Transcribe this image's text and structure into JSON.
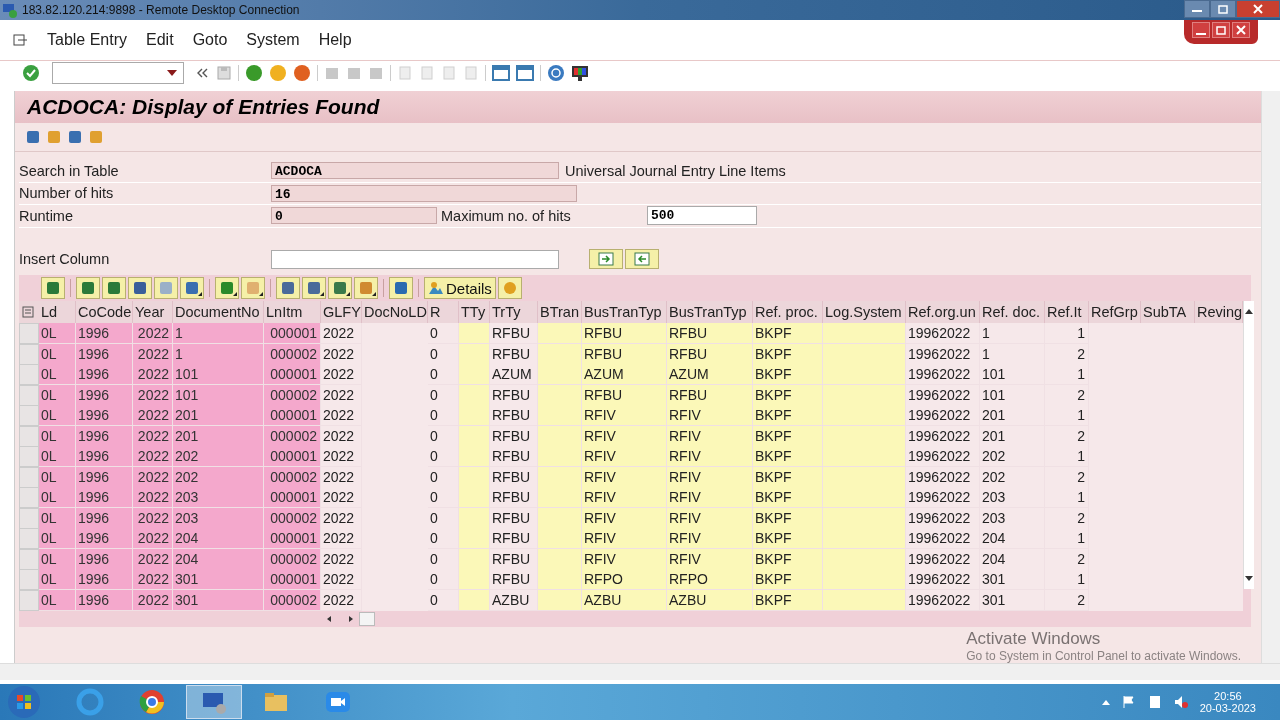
{
  "window": {
    "title": "183.82.120.214:9898 - Remote Desktop Connection"
  },
  "menu": [
    "Table Entry",
    "Edit",
    "Goto",
    "System",
    "Help"
  ],
  "screen_title": "ACDOCA: Display of Entries Found",
  "fields": [
    {
      "label": "Search in Table",
      "value": "ACDOCA",
      "description": "Universal Journal Entry Line Items"
    },
    {
      "label": "Number of hits",
      "value": "16"
    },
    {
      "label": "Runtime",
      "value": "0"
    }
  ],
  "max_hits": {
    "label": "Maximum no. of hits",
    "value": "500"
  },
  "insert_column": {
    "label": "Insert Column"
  },
  "grid": {
    "details_label": "Details",
    "columns": [
      {
        "label": "Ld",
        "kind": "key"
      },
      {
        "label": "CoCode",
        "kind": "key"
      },
      {
        "label": "Year",
        "kind": "key"
      },
      {
        "label": "DocumentNo",
        "kind": "key"
      },
      {
        "label": "LnItm",
        "kind": "key"
      },
      {
        "label": "GLFY",
        "kind": "plain"
      },
      {
        "label": "DocNoLD",
        "kind": "plain"
      },
      {
        "label": "R",
        "kind": "plain"
      },
      {
        "label": "TTy",
        "kind": "input"
      },
      {
        "label": "TrTy",
        "kind": "plain"
      },
      {
        "label": "BTran",
        "kind": "input"
      },
      {
        "label": "BusTranTyp",
        "kind": "input"
      },
      {
        "label": "BusTranTyp",
        "kind": "input"
      },
      {
        "label": "Ref. proc.",
        "kind": "input"
      },
      {
        "label": "Log.System",
        "kind": "input"
      },
      {
        "label": "Ref.org.un",
        "kind": "plain"
      },
      {
        "label": "Ref. doc.",
        "kind": "plain"
      },
      {
        "label": "Ref.It",
        "kind": "plain"
      },
      {
        "label": "RefGrp",
        "kind": "plain"
      },
      {
        "label": "SubTA",
        "kind": "plain"
      },
      {
        "label": "Reving",
        "kind": "plain"
      }
    ],
    "rows": [
      [
        "0L",
        "1996",
        "2022",
        "1",
        "000001",
        "2022",
        null,
        "0",
        null,
        "RFBU",
        null,
        "RFBU",
        "RFBU",
        "BKPF",
        null,
        "19962022",
        "1",
        "1",
        null,
        null,
        null
      ],
      [
        "0L",
        "1996",
        "2022",
        "1",
        "000002",
        "2022",
        null,
        "0",
        null,
        "RFBU",
        null,
        "RFBU",
        "RFBU",
        "BKPF",
        null,
        "19962022",
        "1",
        "2",
        null,
        null,
        null
      ],
      [
        "0L",
        "1996",
        "2022",
        "101",
        "000001",
        "2022",
        null,
        "0",
        null,
        "AZUM",
        null,
        "AZUM",
        "AZUM",
        "BKPF",
        null,
        "19962022",
        "101",
        "1",
        null,
        null,
        null
      ],
      [
        "0L",
        "1996",
        "2022",
        "101",
        "000002",
        "2022",
        null,
        "0",
        null,
        "RFBU",
        null,
        "RFBU",
        "RFBU",
        "BKPF",
        null,
        "19962022",
        "101",
        "2",
        null,
        null,
        null
      ],
      [
        "0L",
        "1996",
        "2022",
        "201",
        "000001",
        "2022",
        null,
        "0",
        null,
        "RFBU",
        null,
        "RFIV",
        "RFIV",
        "BKPF",
        null,
        "19962022",
        "201",
        "1",
        null,
        null,
        null
      ],
      [
        "0L",
        "1996",
        "2022",
        "201",
        "000002",
        "2022",
        null,
        "0",
        null,
        "RFBU",
        null,
        "RFIV",
        "RFIV",
        "BKPF",
        null,
        "19962022",
        "201",
        "2",
        null,
        null,
        null
      ],
      [
        "0L",
        "1996",
        "2022",
        "202",
        "000001",
        "2022",
        null,
        "0",
        null,
        "RFBU",
        null,
        "RFIV",
        "RFIV",
        "BKPF",
        null,
        "19962022",
        "202",
        "1",
        null,
        null,
        null
      ],
      [
        "0L",
        "1996",
        "2022",
        "202",
        "000002",
        "2022",
        null,
        "0",
        null,
        "RFBU",
        null,
        "RFIV",
        "RFIV",
        "BKPF",
        null,
        "19962022",
        "202",
        "2",
        null,
        null,
        null
      ],
      [
        "0L",
        "1996",
        "2022",
        "203",
        "000001",
        "2022",
        null,
        "0",
        null,
        "RFBU",
        null,
        "RFIV",
        "RFIV",
        "BKPF",
        null,
        "19962022",
        "203",
        "1",
        null,
        null,
        null
      ],
      [
        "0L",
        "1996",
        "2022",
        "203",
        "000002",
        "2022",
        null,
        "0",
        null,
        "RFBU",
        null,
        "RFIV",
        "RFIV",
        "BKPF",
        null,
        "19962022",
        "203",
        "2",
        null,
        null,
        null
      ],
      [
        "0L",
        "1996",
        "2022",
        "204",
        "000001",
        "2022",
        null,
        "0",
        null,
        "RFBU",
        null,
        "RFIV",
        "RFIV",
        "BKPF",
        null,
        "19962022",
        "204",
        "1",
        null,
        null,
        null
      ],
      [
        "0L",
        "1996",
        "2022",
        "204",
        "000002",
        "2022",
        null,
        "0",
        null,
        "RFBU",
        null,
        "RFIV",
        "RFIV",
        "BKPF",
        null,
        "19962022",
        "204",
        "2",
        null,
        null,
        null
      ],
      [
        "0L",
        "1996",
        "2022",
        "301",
        "000001",
        "2022",
        null,
        "0",
        null,
        "RFBU",
        null,
        "RFPO",
        "RFPO",
        "BKPF",
        null,
        "19962022",
        "301",
        "1",
        null,
        null,
        null
      ],
      [
        "0L",
        "1996",
        "2022",
        "301",
        "000002",
        "2022",
        null,
        "0",
        null,
        "AZBU",
        null,
        "AZBU",
        "AZBU",
        "BKPF",
        null,
        "19962022",
        "301",
        "2",
        null,
        null,
        null
      ]
    ]
  },
  "watermark": {
    "title": "Activate Windows",
    "text": "Go to System in Control Panel to activate Windows."
  },
  "taskbar": {
    "time": "20:56",
    "date": "20-03-2023"
  }
}
